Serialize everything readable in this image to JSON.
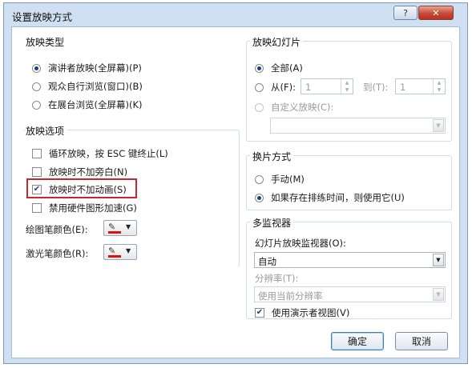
{
  "window": {
    "title": "设置放映方式",
    "help_label": "?",
    "close_label": "✕"
  },
  "show_type": {
    "title": "放映类型",
    "options": [
      {
        "label": "演讲者放映(全屏幕)(P)",
        "selected": true
      },
      {
        "label": "观众自行浏览(窗口)(B)",
        "selected": false
      },
      {
        "label": "在展台浏览(全屏幕)(K)",
        "selected": false
      }
    ]
  },
  "show_options": {
    "title": "放映选项",
    "checks": [
      {
        "label": "循环放映，按 ESC 键终止(L)",
        "checked": false
      },
      {
        "label": "放映时不加旁白(N)",
        "checked": false
      },
      {
        "label": "放映时不加动画(S)",
        "checked": true
      },
      {
        "label": "禁用硬件图形加速(G)",
        "checked": false
      }
    ],
    "pen_color_label": "绘图笔颜色(E):",
    "laser_color_label": "激光笔颜色(R):",
    "pen_color": "#e01010",
    "laser_color": "#e01010"
  },
  "show_slides": {
    "title": "放映幻灯片",
    "all_label": "全部(A)",
    "from_label": "从(F):",
    "from_value": "1",
    "to_label": "到(T):",
    "to_value": "1",
    "custom_label": "自定义放映(C):",
    "custom_value": ""
  },
  "advance": {
    "title": "换片方式",
    "manual_label": "手动(M)",
    "timings_label": "如果存在排练时间，则使用它(U)"
  },
  "monitors": {
    "title": "多监视器",
    "monitor_label": "幻灯片放映监视器(O):",
    "monitor_value": "自动",
    "resolution_label": "分辨率(T):",
    "resolution_value": "使用当前分辨率",
    "presenter_view_label": "使用演示者视图(V)",
    "presenter_view_checked": true
  },
  "buttons": {
    "ok": "确定",
    "cancel": "取消"
  },
  "colors": {
    "highlight": "#c9262c",
    "dialog_frame": "#cfe0f2"
  }
}
